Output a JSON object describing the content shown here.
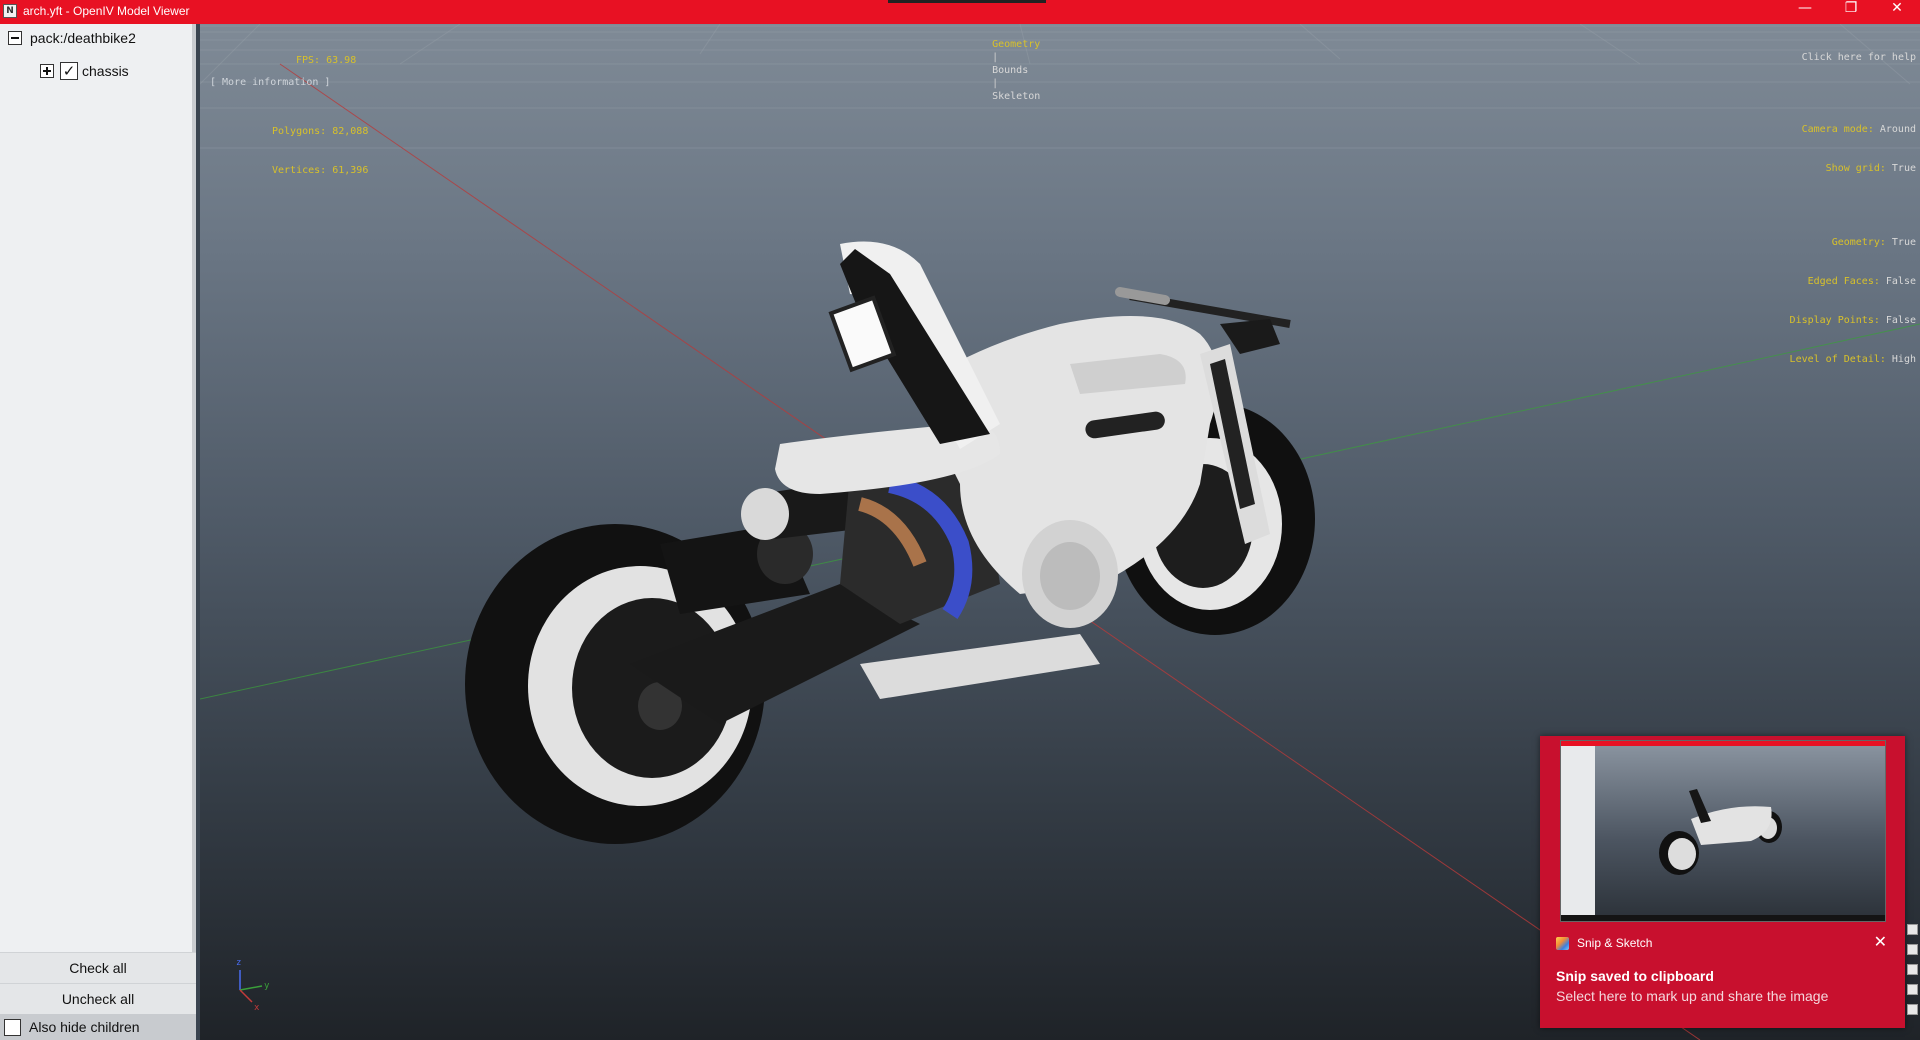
{
  "window": {
    "title": "arch.yft - OpenIV Model Viewer",
    "app_icon": "N",
    "minimize_icon": "—",
    "restore_icon": "❐",
    "close_icon": "✕",
    "accent_color": "#e81123"
  },
  "tree": {
    "root_label": "pack:/deathbike2",
    "child_label": "chassis",
    "child_checked_glyph": "✓"
  },
  "panel": {
    "check_all": "Check all",
    "uncheck_all": "Uncheck all",
    "also_hide_children": "Also hide children"
  },
  "hud": {
    "fps_label": "FPS:",
    "fps_value": "63.98",
    "polygons_label": "Polygons:",
    "polygons_value": "82,088",
    "vertices_label": "Vertices:",
    "vertices_value": "61,396",
    "more_information": "[ More information ]",
    "view_modes": [
      "Geometry",
      "Bounds",
      "Skeleton"
    ],
    "view_mode_separator": "|",
    "help_link": "Click here for help",
    "camera_mode_label": "Camera mode:",
    "camera_mode_value": "Around",
    "show_grid_label": "Show grid:",
    "show_grid_value": "True",
    "geometry_label": "Geometry:",
    "geometry_value": "True",
    "edged_faces_label": "Edged Faces:",
    "edged_faces_value": "False",
    "display_points_label": "Display Points:",
    "display_points_value": "False",
    "lod_label": "Level of Detail:",
    "lod_value": "High"
  },
  "axis_gizmo": {
    "z": "z",
    "y": "y",
    "x": "x"
  },
  "toast": {
    "app_name": "Snip & Sketch",
    "close_icon": "✕",
    "headline": "Snip saved to clipboard",
    "subtext": "Select here to mark up and share the image",
    "background": "#c8102e"
  }
}
